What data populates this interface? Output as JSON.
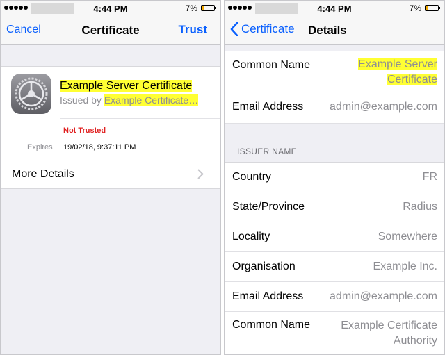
{
  "left_screen": {
    "status": {
      "time": "4:44 PM",
      "battery": "7%"
    },
    "nav": {
      "left": "Cancel",
      "title": "Certificate",
      "right": "Trust"
    },
    "cert": {
      "title": "Example Server Certificate",
      "issued_by_prefix": "Issued by ",
      "issuer": "Example Certificate…",
      "trust_status": "Not Trusted",
      "expires_label": "Expires",
      "expires_value": "19/02/18, 9:37:11 PM"
    },
    "more_details": "More Details",
    "icons": {
      "app": "settings-gear-icon",
      "chevron": "chevron-right-icon"
    }
  },
  "right_screen": {
    "status": {
      "time": "4:44 PM",
      "battery": "7%"
    },
    "nav": {
      "back": "Certificate",
      "title": "Details"
    },
    "subject": [
      {
        "key": "Common Name",
        "value_line1": "Example Server",
        "value_line2": "Certificate"
      },
      {
        "key": "Email Address",
        "value": "admin@example.com"
      }
    ],
    "issuer_section": "ISSUER NAME",
    "issuer": [
      {
        "key": "Country",
        "value": "FR"
      },
      {
        "key": "State/Province",
        "value": "Radius"
      },
      {
        "key": "Locality",
        "value": "Somewhere"
      },
      {
        "key": "Organisation",
        "value": "Example Inc."
      },
      {
        "key": "Email Address",
        "value": "admin@example.com"
      },
      {
        "key": "Common Name",
        "value_line1": "Example Certificate",
        "value_line2": "Authority"
      }
    ]
  },
  "colors": {
    "ios_blue": "#0a60fe",
    "highlight": "#ffff33",
    "warning_red": "#e02020"
  }
}
